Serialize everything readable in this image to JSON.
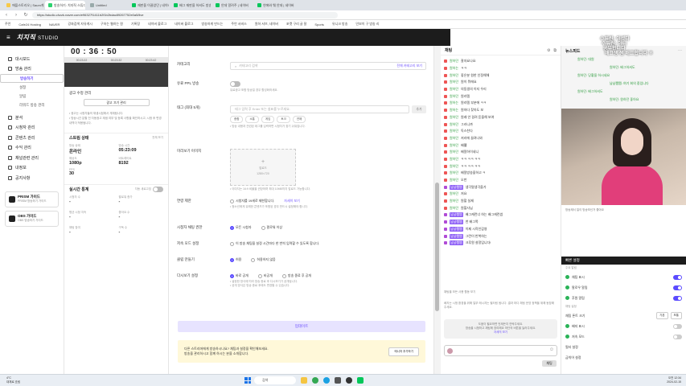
{
  "browser": {
    "tabs": [
      {
        "label": "애플스토리오 | Saum게임",
        "color": "#f7c948"
      },
      {
        "label": "방송하기: 치지직 스튜디오",
        "color": "#2dd36f",
        "active": true
      },
      {
        "label": "Untitled",
        "color": "#9aa"
      },
      {
        "label": "재판을 이끌었던 | 네이버",
        "color": "#03c75a"
      },
      {
        "label": "배그 재판을 하셔도 방송",
        "color": "#03c75a"
      },
      {
        "label": "안데 알려주 | 네이버",
        "color": "#03c75a"
      },
      {
        "label": "연애와 웨 안데 | 네이버",
        "color": "#03c75a"
      }
    ],
    "url": "https://studio.chzzk.naver.com/e96327f1411b2f1b2bdac89267752e0a5/live",
    "bookmarks": [
      "주언",
      "Cafe24 Hosting",
      "NAVER",
      "강좌검색 자유게시",
      "구하는 웹하는 원",
      "기록장",
      "네이버 블로그",
      "네이버 블로그",
      "방송하게 만드는",
      "주언 서비스",
      "원하 서브, 네이버",
      "포켓 구리 글 잘",
      "Sports",
      "유니크 방송",
      "인보이 구 방송 리"
    ]
  },
  "app": {
    "logo": "치지직",
    "logo_suffix": "STUDIO"
  },
  "sidebar": {
    "items": [
      {
        "label": "대시보드",
        "icon": "dashboard-icon"
      },
      {
        "label": "방송 관리",
        "icon": "broadcast-icon"
      },
      {
        "label": "방송하기",
        "sub": true,
        "selected": true
      },
      {
        "label": "설정",
        "sub": true
      },
      {
        "label": "알림",
        "sub": true
      },
      {
        "label": "리워드 방송 관리",
        "sub": true
      },
      {
        "label": "분석",
        "icon": "chart-icon"
      },
      {
        "label": "시청자 관리",
        "icon": "users-icon"
      },
      {
        "label": "콘텐츠 관리",
        "icon": "content-icon"
      },
      {
        "label": "수익 관리",
        "icon": "money-icon"
      },
      {
        "label": "채널관련 관리",
        "icon": "channel-icon"
      },
      {
        "label": "내정보",
        "icon": "user-icon"
      },
      {
        "label": "공지사항",
        "icon": "notice-icon"
      }
    ],
    "cards": [
      {
        "title": "PRISM 가이드",
        "desc": "PRISM 방송하기 가이드"
      },
      {
        "title": "OBS 가이드",
        "desc": "OBS 방송하기 가이드"
      }
    ]
  },
  "left_panel": {
    "timer": "00 : 36 : 50",
    "timeline": [
      "00:23:22",
      "00:23:32",
      "00:23:42"
    ],
    "key_title": "광고 수정 관리",
    "key_button": "광고 끄기 관리",
    "notes": "• 광고는 시청자들의 재생시점에서 게재됩니다.\n• 방송시간 분할 전 자동광고 재생 여부 및 등록 사항을 확인하시고, 시청 후 변경 내역이 적용됩니다.",
    "status_title": "스트림 상태",
    "status_more": "전체 보기",
    "stats": [
      {
        "label": "방송 상태",
        "value": "온라인"
      },
      {
        "label": "방송 시간",
        "value": "05:23:09"
      },
      {
        "label": "해상도",
        "value": "1080p"
      },
      {
        "label": "비트레이트",
        "value": "8192"
      },
      {
        "label": "FPS",
        "value": "30"
      }
    ],
    "realtime_title": "실시간 통계",
    "realtime_toggle": "자동 새로고침",
    "realtime": [
      {
        "label": "시청자 수",
        "value": "-"
      },
      {
        "label": "팔로워 증가",
        "value": "-"
      },
      {
        "label": "평균 시청 지속",
        "value": "-"
      },
      {
        "label": "좋아요 수",
        "value": "-"
      },
      {
        "label": "채팅 참여",
        "value": "-"
      },
      {
        "label": "구독 수",
        "value": "-"
      }
    ]
  },
  "form": {
    "category_label": "카테고리",
    "category_placeholder": "카테고리 검색",
    "category_link": "전체 카테고리 보기",
    "paid_label": "유료 PPL 방송",
    "paid_hint": "유료광고 포함 방송일 경우 활성화하세요.",
    "tag_label": "태그 (최대 5개)",
    "tag_placeholder": "태그 입력 후 Enter 또는 쉼표를 누르세요.",
    "tag_add": "추가",
    "tags": [
      "종합",
      "소통",
      "게임",
      "토크",
      "연애"
    ],
    "tag_hint": "• 방송 내용과 관련된 태그를 입력하면 시청자가 찾기 쉬워집니다.",
    "thumb_label": "미리보기 이미지",
    "thumb_button": "업로드",
    "thumb_size": "1280×720",
    "thumb_hint": "• 이미지는 16:9 비율을 권장하며 최대 10MB까지 업로드 가능합니다.",
    "age_label": "연령 제한",
    "age_option": "시청자를 19세로 제한합니다.",
    "age_link": "자세히 보기",
    "age_hint": "• 청소년에게 유해한 콘텐츠가 포함된 경우 반드시 설정해야 합니다.",
    "chat_label": "시청자 채팅 권한",
    "chat_options": [
      "모든 시청자",
      "팔로워 이상"
    ],
    "slow_label": "저속 모드 설정",
    "slow_option": "이 방송 채팅을 설정 시간마다 한 번씩 입력할 수 있도록 합니다.",
    "clip_label": "클립 만들기",
    "clip_options": [
      "허용",
      "허용하지 않음"
    ],
    "donation_label": "다시보기 설정",
    "donation_options": [
      "바로 공개",
      "비공개",
      "방송 종료 후 공개"
    ],
    "donation_hint": "• 설정한 방식에 따라 방송 종료 후 다시보기가 공개됩니다.\n• 공개 방식은 방송 종료 후에도 변경할 수 있습니다.",
    "save": "업데이트",
    "notice_text": "다른 스트리머에게 방송하시나요? 채팅과 설정을 확인해보세요.\n방송을 관리하시고 함께 하시는 분을 소개합니다.",
    "notice_button": "매니저 추가하기"
  },
  "chat": {
    "title": "채팅",
    "messages": [
      {
        "nick": "원하던",
        "text": "잘자요나요",
        "badge": "r"
      },
      {
        "nick": "원하는",
        "text": "ㅋㅋ",
        "badge": "r"
      },
      {
        "nick": "원하던",
        "text": "좋은분 원한 인정해해",
        "badge": "r"
      },
      {
        "nick": "원하던",
        "text": "원이 뭐에요",
        "badge": "r"
      },
      {
        "nick": "원하던",
        "text": "의동생의 이지 우리",
        "badge": "r"
      },
      {
        "nick": "원하던",
        "text": "원리템",
        "badge": "r"
      },
      {
        "nick": "원하는",
        "text": "원리템 부분에 ㅋㅋ",
        "badge": "r"
      },
      {
        "nick": "원하는",
        "text": "원하다 찾아도 보",
        "badge": "r"
      },
      {
        "nick": "원하던",
        "text": "원래 안 걸려 듣을해 보여",
        "badge": "r"
      },
      {
        "nick": "원하던",
        "text": "그러니까",
        "badge": "r"
      },
      {
        "nick": "원하던",
        "text": "독스찬다",
        "badge": "r"
      },
      {
        "nick": "원하던",
        "text": "저리에 끌려나와",
        "badge": "r"
      },
      {
        "nick": "원하던",
        "text": "배웰",
        "badge": "r"
      },
      {
        "nick": "원하던",
        "text": "배알하이네니",
        "badge": "r"
      },
      {
        "nick": "원하던",
        "text": "ㅋㅋ ㅋㅋ ㅋㅋ",
        "badge": "r"
      },
      {
        "nick": "원하던",
        "text": "ㅋㅋ ㅋㅋ ㅋㅋ",
        "badge": "r"
      },
      {
        "nick": "원하던",
        "text": "배알방송을하고 ㅋ",
        "badge": "r"
      },
      {
        "nick": "원하던",
        "text": "오반",
        "badge": "r"
      },
      {
        "nick": "냠냠쨈쨈",
        "text": "생각말생각을가",
        "badge": "p"
      },
      {
        "nick": "원하던",
        "text": "저요",
        "badge": "r"
      },
      {
        "nick": "원하던",
        "text": "원할 실제",
        "badge": "r"
      },
      {
        "nick": "원하던",
        "text": "원할사님",
        "badge": "r"
      },
      {
        "nick": "냠냠쨈쨈",
        "text": "배그캐런너 하는 배그캐런썸",
        "badge": "p"
      },
      {
        "nick": "냠냠쨈쨈",
        "text": "천 배그쪽",
        "badge": "p"
      },
      {
        "nick": "냠냠쨈쨈",
        "text": "이제 시작인감영",
        "badge": "p"
      },
      {
        "nick": "냠냠쨈쨈",
        "text": "그런이 반복하는",
        "badge": "p"
      },
      {
        "nick": "냠냠쨈쨈",
        "text": "크루원 설정입니다!",
        "badge": "p"
      }
    ],
    "notice": "채팅을 모든 사용 활동 보기",
    "rule_note": "배지는 시청 환경을 위해 일부 메시지는 필터링 됩니다. 결과 마다 채팅 운영 정책을 위해 동참해 주세요.",
    "box_text": "도움이 필요하면 언제든지 연락주세요.\n방송을 시청하고 채팅에 참여해요 하단의 버튼을 눌러주세요.",
    "box_link": "자세히 보기",
    "send": "채팅"
  },
  "right": {
    "news_title": "뉴스피드",
    "overlay_top": [
      "수튜린: 이셨다",
      "수튜린: 아니",
      "공부합니다",
      "배그쟁 썸 배그합니다 ㅎ"
    ],
    "overlay_msgs": [
      "원하던: 대원",
      "원하던: 배그하셔도",
      "원하던: 당황을 하시네요",
      "냠냠쨈쨈: 여기 회의 중입니다",
      "원하던: 배그하셔도",
      "원하던: 원하던 좋아요"
    ],
    "video_caption": "방송제서 일이 방송보신거 좋아요",
    "settings_title": "빠른 설정",
    "settings_sub": "주요 알림",
    "settings": [
      {
        "label": "채팅 표시",
        "on": true
      },
      {
        "label": "팔로우 알림",
        "on": true
      },
      {
        "label": "후원 알림",
        "on": true
      }
    ],
    "chat_settings_title": "채팅 설정",
    "font_label": "채팅 폰트 크기",
    "font_selects": [
      "기본",
      "보통"
    ],
    "toggles": [
      {
        "label": "배지 표시",
        "on": false
      },
      {
        "label": "저속 모드",
        "on": false
      }
    ],
    "links": [
      "필터 설정",
      "금칙어 설정"
    ]
  },
  "taskbar": {
    "weather_temp": "4°C",
    "weather_desc": "대체로 흐림",
    "search": "검색",
    "time": "오전 12:34",
    "date": "2024-02-15"
  }
}
